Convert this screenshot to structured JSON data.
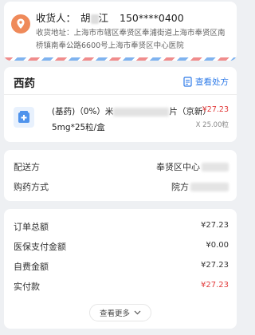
{
  "address": {
    "receiver_label": "收货人：",
    "receiver_name_first": "胡",
    "receiver_name_last": "江",
    "phone": "150****0400",
    "address_label": "收货地址：",
    "address_text": "上海市市辖区奉贤区奉浦街道上海市奉贤区南桥镇南奉公路6600号上海市奉贤区中心医院"
  },
  "medicine": {
    "section_title": "西药",
    "view_prescription": "查看处方",
    "drug_name_prefix": "(基药)（0%）米",
    "drug_name_suffix": "片（京新）",
    "drug_spec": "5mg*25粒/盒",
    "price": "¥27.23",
    "quantity": "X 25.00粒"
  },
  "delivery": {
    "delivery_label": "配送方",
    "delivery_value": "奉贤区中心",
    "purchase_label": "购药方式",
    "purchase_value": "院方"
  },
  "summary": {
    "rows": [
      {
        "label": "订单总额",
        "value": "¥27.23"
      },
      {
        "label": "医保支付金额",
        "value": "¥0.00"
      },
      {
        "label": "自费金额",
        "value": "¥27.23"
      },
      {
        "label": "实付款",
        "value": "¥27.23"
      }
    ],
    "more_label": "查看更多"
  },
  "colors": {
    "accent_blue": "#2f7be8",
    "price_red": "#e23b3b",
    "location_orange": "#ef8a5a"
  }
}
